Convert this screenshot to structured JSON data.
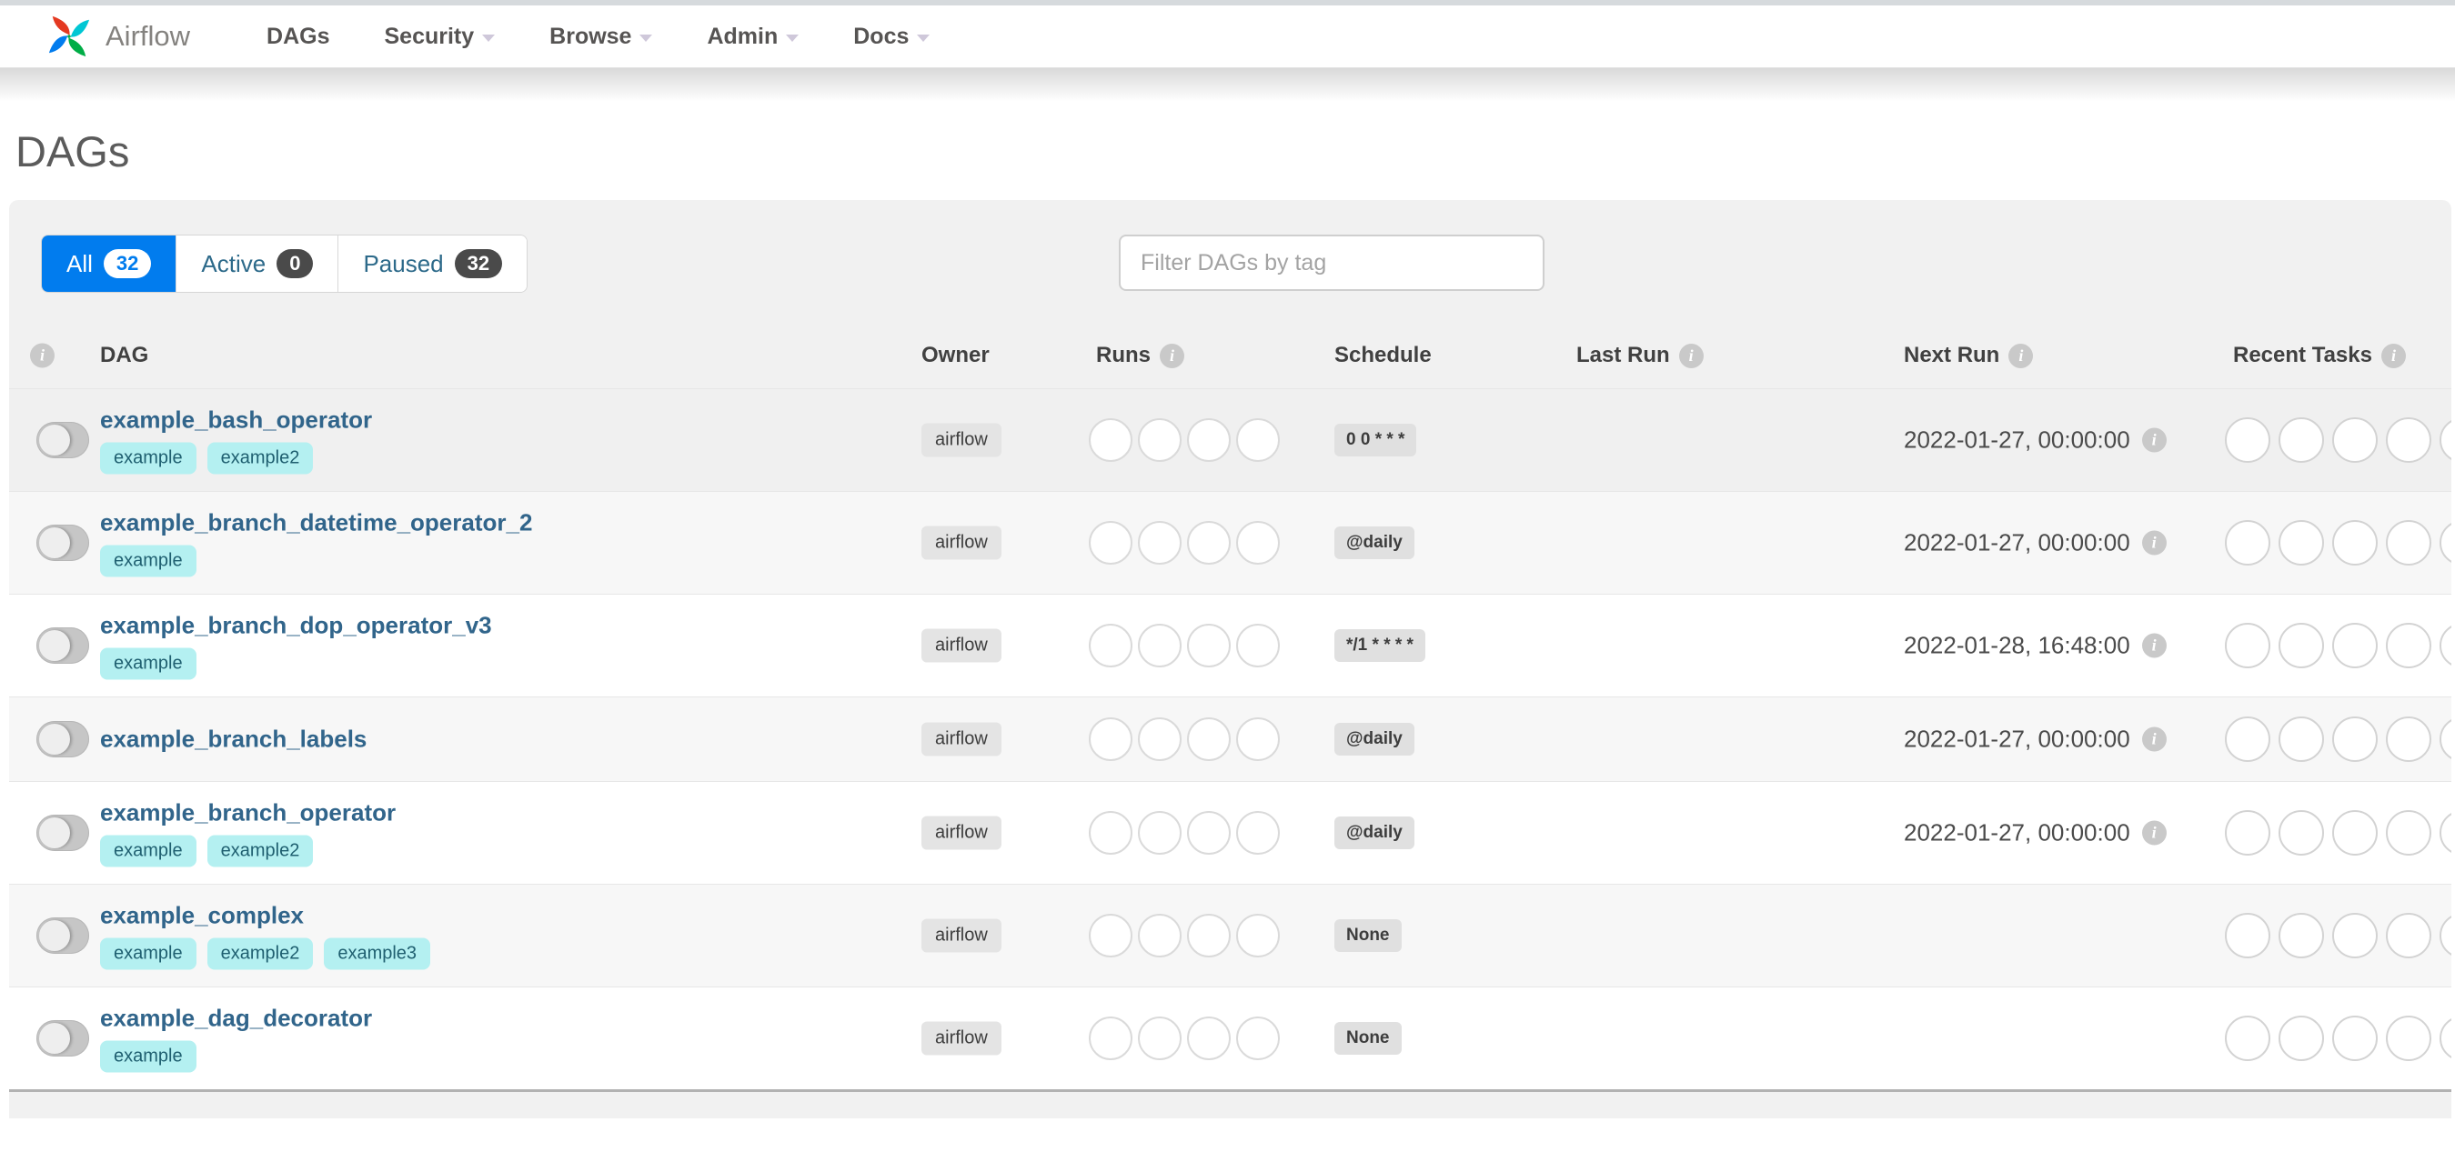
{
  "navbar": {
    "brand": "Airflow",
    "items": [
      {
        "label": "DAGs",
        "caret": false
      },
      {
        "label": "Security",
        "caret": true
      },
      {
        "label": "Browse",
        "caret": true
      },
      {
        "label": "Admin",
        "caret": true
      },
      {
        "label": "Docs",
        "caret": true
      }
    ]
  },
  "page": {
    "title": "DAGs"
  },
  "filters": {
    "tabs": [
      {
        "label": "All",
        "count": "32",
        "active": true
      },
      {
        "label": "Active",
        "count": "0",
        "active": false
      },
      {
        "label": "Paused",
        "count": "32",
        "active": false
      }
    ],
    "search_placeholder": "Filter DAGs by tag"
  },
  "table": {
    "columns": {
      "dag": "DAG",
      "owner": "Owner",
      "runs": "Runs",
      "schedule": "Schedule",
      "last_run": "Last Run",
      "next_run": "Next Run",
      "recent_tasks": "Recent Tasks"
    },
    "rows": [
      {
        "name": "example_bash_operator",
        "tags": [
          "example",
          "example2"
        ],
        "owner": "airflow",
        "runs": 4,
        "schedule": "0 0 * * *",
        "last_run": "",
        "next_run": "2022-01-27, 00:00:00",
        "recent_tasks": 5
      },
      {
        "name": "example_branch_datetime_operator_2",
        "tags": [
          "example"
        ],
        "owner": "airflow",
        "runs": 4,
        "schedule": "@daily",
        "last_run": "",
        "next_run": "2022-01-27, 00:00:00",
        "recent_tasks": 5
      },
      {
        "name": "example_branch_dop_operator_v3",
        "tags": [
          "example"
        ],
        "owner": "airflow",
        "runs": 4,
        "schedule": "*/1 * * * *",
        "last_run": "",
        "next_run": "2022-01-28, 16:48:00",
        "recent_tasks": 5
      },
      {
        "name": "example_branch_labels",
        "tags": [],
        "owner": "airflow",
        "runs": 4,
        "schedule": "@daily",
        "last_run": "",
        "next_run": "2022-01-27, 00:00:00",
        "recent_tasks": 5
      },
      {
        "name": "example_branch_operator",
        "tags": [
          "example",
          "example2"
        ],
        "owner": "airflow",
        "runs": 4,
        "schedule": "@daily",
        "last_run": "",
        "next_run": "2022-01-27, 00:00:00",
        "recent_tasks": 5
      },
      {
        "name": "example_complex",
        "tags": [
          "example",
          "example2",
          "example3"
        ],
        "owner": "airflow",
        "runs": 4,
        "schedule": "None",
        "last_run": "",
        "next_run": "",
        "recent_tasks": 5
      },
      {
        "name": "example_dag_decorator",
        "tags": [
          "example"
        ],
        "owner": "airflow",
        "runs": 4,
        "schedule": "None",
        "last_run": "",
        "next_run": "",
        "recent_tasks": 5
      }
    ]
  },
  "colors": {
    "accent_blue": "#017cee",
    "logo_red": "#e43921",
    "logo_cyan": "#00c7d4",
    "logo_blue": "#017cee",
    "logo_green": "#00ad46",
    "tag_bg": "#b4f0f1",
    "tag_text": "#1f5f70",
    "badge_gray": "#e0e0e0",
    "count_badge_dark": "#4a4a4a",
    "link_steel_blue": "#31658b"
  }
}
